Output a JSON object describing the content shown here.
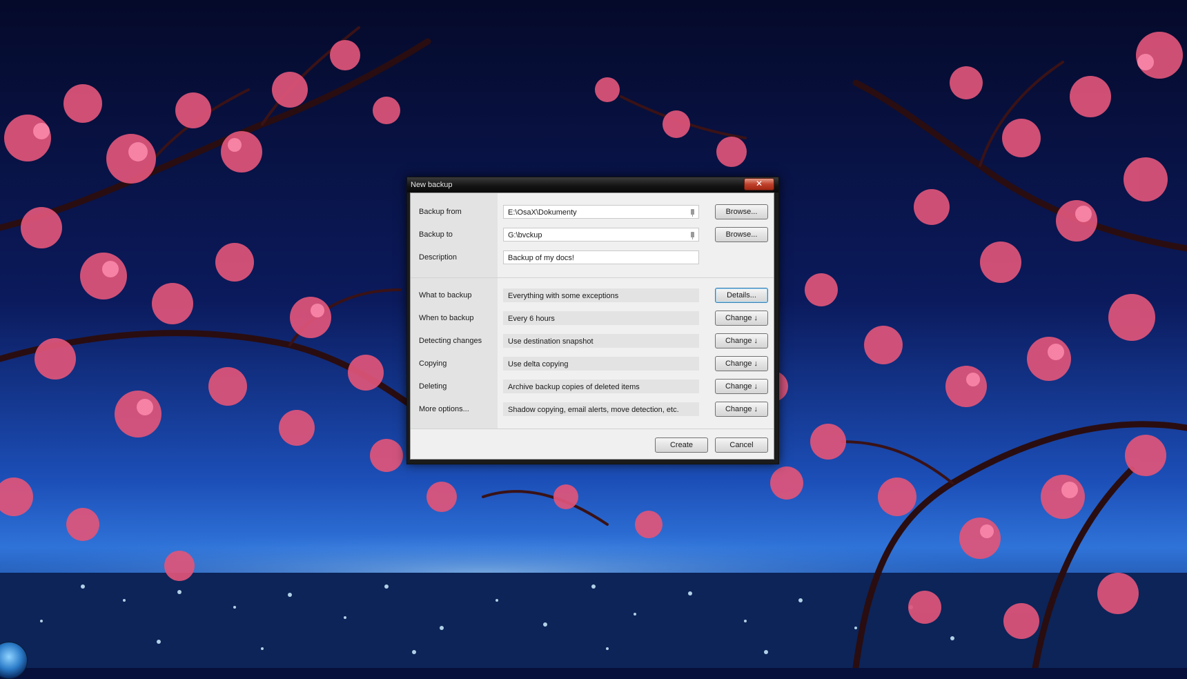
{
  "window": {
    "title": "New backup",
    "close_glyph": "✕"
  },
  "source": {
    "label": "Backup from",
    "value": "E:\\OsaX\\Dokumenty",
    "browse_label": "Browse..."
  },
  "destination": {
    "label": "Backup to",
    "value": "G:\\bvckup",
    "browse_label": "Browse..."
  },
  "description": {
    "label": "Description",
    "value": "Backup of my docs!"
  },
  "options": [
    {
      "label": "What to backup",
      "value": "Everything with some exceptions",
      "button": "Details..."
    },
    {
      "label": "When to backup",
      "value": "Every 6 hours",
      "button": "Change ↓"
    },
    {
      "label": "Detecting changes",
      "value": "Use destination snapshot",
      "button": "Change ↓"
    },
    {
      "label": "Copying",
      "value": "Use delta copying",
      "button": "Change ↓"
    },
    {
      "label": "Deleting",
      "value": "Archive backup copies of deleted items",
      "button": "Change ↓"
    },
    {
      "label": "More options...",
      "value": "Shadow copying, email alerts, move detection, etc.",
      "button": "Change ↓"
    }
  ],
  "footer": {
    "create_label": "Create",
    "cancel_label": "Cancel"
  },
  "icons": {
    "pin": "pin-icon",
    "close": "close-icon",
    "start": "windows-start-orb"
  },
  "colors": {
    "sky": "#06103a",
    "blossom": "#e0557a",
    "city_lights": "#9ad8ff",
    "close_button": "#c0402a"
  }
}
